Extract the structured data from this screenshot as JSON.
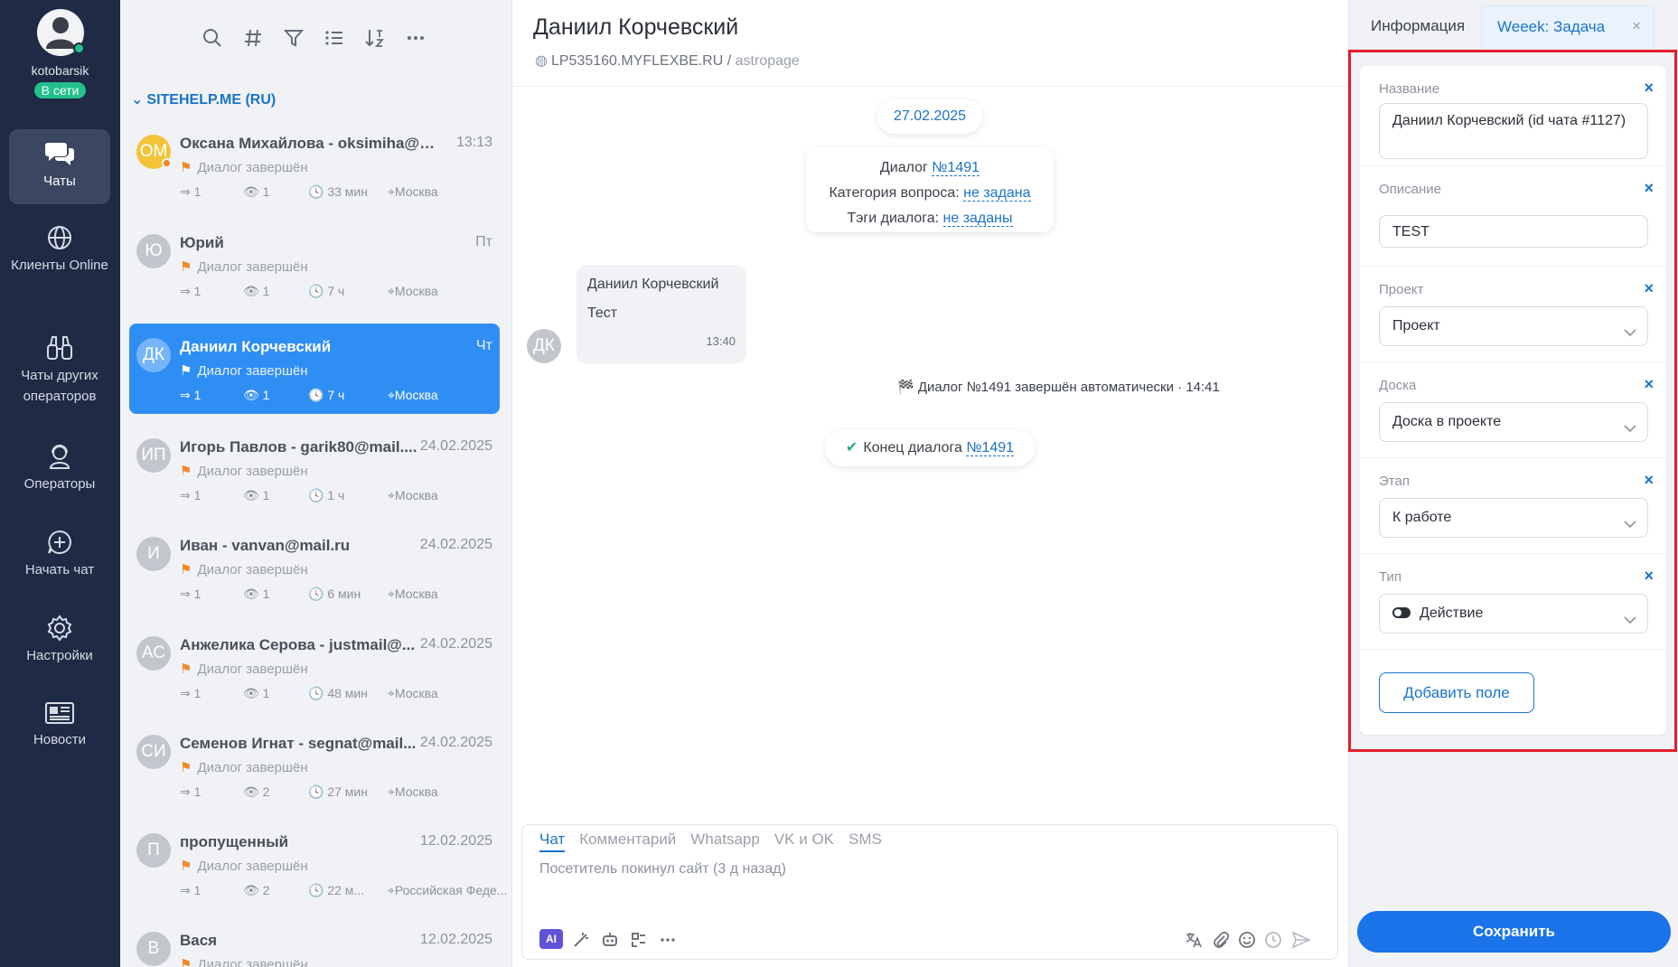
{
  "user": {
    "name": "kotobarsik",
    "status": "В сети"
  },
  "nav": [
    {
      "label": "Чаты",
      "icon": "chat-bubbles-icon"
    },
    {
      "label": "Клиенты Online",
      "icon": "globe-icon"
    },
    {
      "label": "Чаты других операторов",
      "icon": "binoculars-icon"
    },
    {
      "label": "Операторы",
      "icon": "operator-icon"
    },
    {
      "label": "Начать чат",
      "icon": "add-chat-icon"
    },
    {
      "label": "Настройки",
      "icon": "gear-icon"
    },
    {
      "label": "Новости",
      "icon": "news-icon"
    }
  ],
  "toolbar": [
    "search-icon",
    "hashtag-icon",
    "filter-icon",
    "list-icon",
    "sort-icon",
    "more-icon"
  ],
  "group": "SITEHELP.ME (RU)",
  "chats": [
    {
      "initials": "ОМ",
      "name": "Оксана Михайлова - oksimiha@m...",
      "time": "13:13",
      "status": "Диалог завершён",
      "msgs": "1",
      "views": "1",
      "dur": "33 мин",
      "loc": "Москва"
    },
    {
      "initials": "Ю",
      "name": "Юрий",
      "time": "Пт",
      "status": "Диалог завершён",
      "msgs": "1",
      "views": "1",
      "dur": "7 ч",
      "loc": "Москва"
    },
    {
      "initials": "ДК",
      "name": "Даниил Корчевский",
      "time": "Чт",
      "status": "Диалог завершён",
      "msgs": "1",
      "views": "1",
      "dur": "7 ч",
      "loc": "Москва"
    },
    {
      "initials": "ИП",
      "name": "Игорь Павлов - garik80@mail....",
      "time": "24.02.2025",
      "status": "Диалог завершён",
      "msgs": "1",
      "views": "1",
      "dur": "1 ч",
      "loc": "Москва"
    },
    {
      "initials": "И",
      "name": "Иван - vanvan@mail.ru",
      "time": "24.02.2025",
      "status": "Диалог завершён",
      "msgs": "1",
      "views": "1",
      "dur": "6 мин",
      "loc": "Москва"
    },
    {
      "initials": "АС",
      "name": "Анжелика Серова - justmail@...",
      "time": "24.02.2025",
      "status": "Диалог завершён",
      "msgs": "1",
      "views": "1",
      "dur": "48 мин",
      "loc": "Москва"
    },
    {
      "initials": "СИ",
      "name": "Семенов Игнат - segnat@mail...",
      "time": "24.02.2025",
      "status": "Диалог завершён",
      "msgs": "1",
      "views": "2",
      "dur": "27 мин",
      "loc": "Москва"
    },
    {
      "initials": "П",
      "name": "пропущенный",
      "time": "12.02.2025",
      "status": "Диалог завершён",
      "msgs": "1",
      "views": "2",
      "dur": "22 м...",
      "loc": "Российская Феде..."
    },
    {
      "initials": "В",
      "name": "Вася",
      "time": "12.02.2025",
      "status": "Диалог завершён",
      "msgs": "",
      "views": "",
      "dur": "",
      "loc": ""
    }
  ],
  "conversation": {
    "title": "Даниил Корчевский",
    "site": "LP535160.MYFLEXBE.RU",
    "page": "astropage",
    "date": "27.02.2025",
    "info": {
      "dialog_label": "Диалог",
      "dialog_num": "№1491",
      "category_label": "Категория вопроса:",
      "category_value": "не задана",
      "tags_label": "Тэги диалога:",
      "tags_value": "не заданы"
    },
    "message": {
      "author": "Даниил Корчевский",
      "text": "Тест",
      "time": "13:40",
      "initials": "ДК"
    },
    "system": "Диалог №1491 завершён автоматически · 14:41",
    "end_label": "Конец диалога",
    "end_num": "№1491"
  },
  "composer": {
    "tabs": [
      "Чат",
      "Комментарий",
      "Whatsapp",
      "VK и OK",
      "SMS"
    ],
    "placeholder": "Посетитель покинул сайт (3 д назад)",
    "ai": "AI"
  },
  "panel": {
    "tab_info": "Информация",
    "tab_task": "Weeek: Задача",
    "fields": [
      {
        "label": "Название",
        "value": "Даниил Корчевский (id чата #1127)"
      },
      {
        "label": "Описание",
        "value": "TEST"
      },
      {
        "label": "Проект",
        "value": "Проект"
      },
      {
        "label": "Доска",
        "value": "Доска в проекте"
      },
      {
        "label": "Этап",
        "value": "К работе"
      },
      {
        "label": "Тип",
        "value": "Действие"
      }
    ],
    "add_field": "Добавить поле",
    "save": "Сохранить"
  },
  "colors": {
    "nav_bg": "#1f2a44",
    "accent": "#1a73c9",
    "active_chat": "#2f8ef4",
    "online": "#22c08b",
    "highlight": "#e21d2c",
    "save": "#1a73e8"
  }
}
